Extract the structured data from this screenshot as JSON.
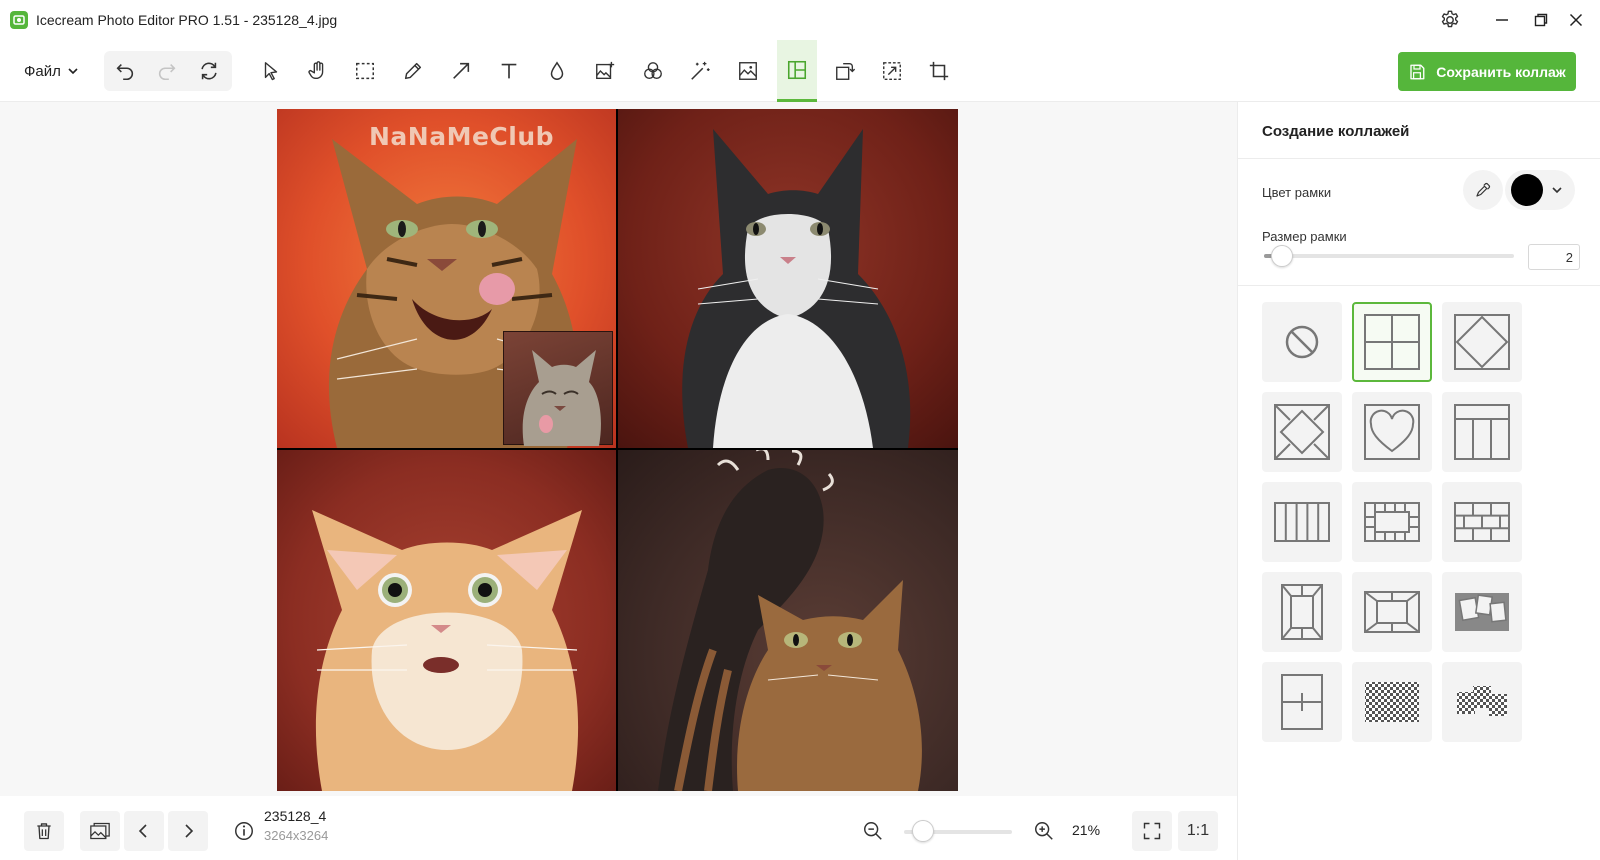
{
  "window": {
    "title": "Icecream Photo Editor PRO 1.51 - 235128_4.jpg"
  },
  "toolbar": {
    "file_label": "Файл",
    "save_label": "Сохранить коллаж",
    "active_tool": "collage"
  },
  "canvas": {
    "watermark": "NaNaMeClub"
  },
  "status": {
    "file_name": "235128_4",
    "file_dims": "3264x3264",
    "zoom": "21%",
    "actual_size_label": "1:1"
  },
  "panel": {
    "title": "Создание коллажей",
    "border_color_label": "Цвет рамки",
    "border_color": "#000000",
    "border_size_label": "Размер рамки",
    "border_size": "2"
  },
  "colors": {
    "accent": "#55b63b",
    "active_tool_bg": "#e8f5e2"
  }
}
